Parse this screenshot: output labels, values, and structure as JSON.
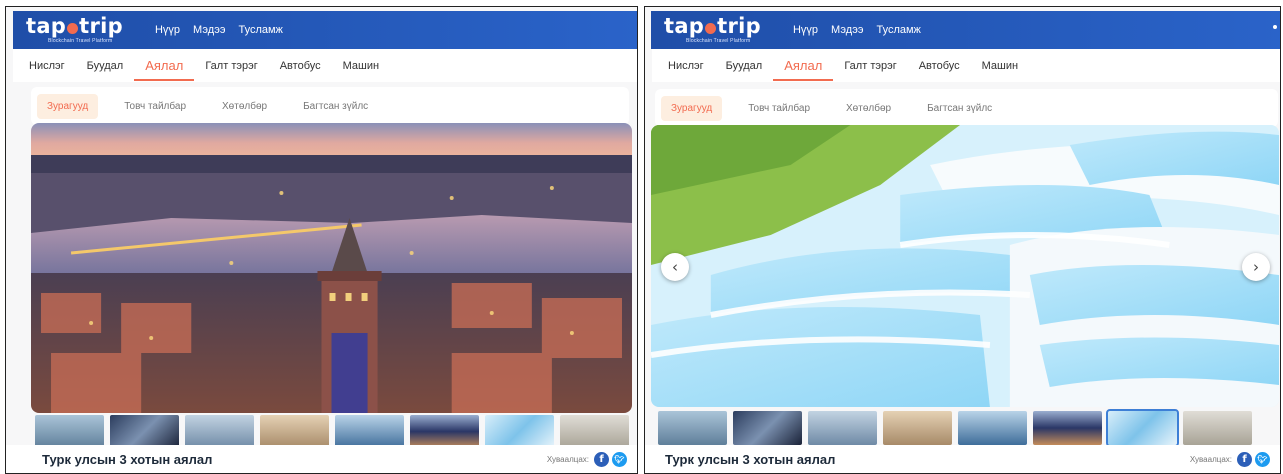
{
  "logo": {
    "before_o": "tap",
    "after_o": "trip",
    "tagline": "Blockchain Travel Platform"
  },
  "topnav": [
    "Нүүр",
    "Мэдээ",
    "Тусламж"
  ],
  "categories": [
    "Нислэг",
    "Буудал",
    "Аялал",
    "Галт тэрэг",
    "Автобус",
    "Машин"
  ],
  "active_category": "Аялал",
  "subtabs": [
    "Зурагууд",
    "Товч тайлбар",
    "Хөтөлбөр",
    "Багтсан зүйлс"
  ],
  "active_subtab": "Зурагууд",
  "tour_title": "Турк улсын 3 хотын аялал",
  "share_label": "Хуваалцах:",
  "icons": {
    "share_facebook": "facebook-icon",
    "share_twitter": "twitter-icon",
    "carousel_prev": "chevron-left-icon",
    "carousel_next": "chevron-right-icon"
  },
  "colors": {
    "header": "#2a5bbd",
    "accent": "#f26b4f",
    "active_tab_bg": "#fdeee0"
  },
  "frames": [
    {
      "name": "left",
      "photo": "istanbul-galata-tower",
      "selected_thumb": 5,
      "thumb_count": 8,
      "arrows": false
    },
    {
      "name": "right",
      "photo": "pamukkale-travertines",
      "selected_thumb": 6,
      "thumb_count": 8,
      "arrows": true
    }
  ]
}
